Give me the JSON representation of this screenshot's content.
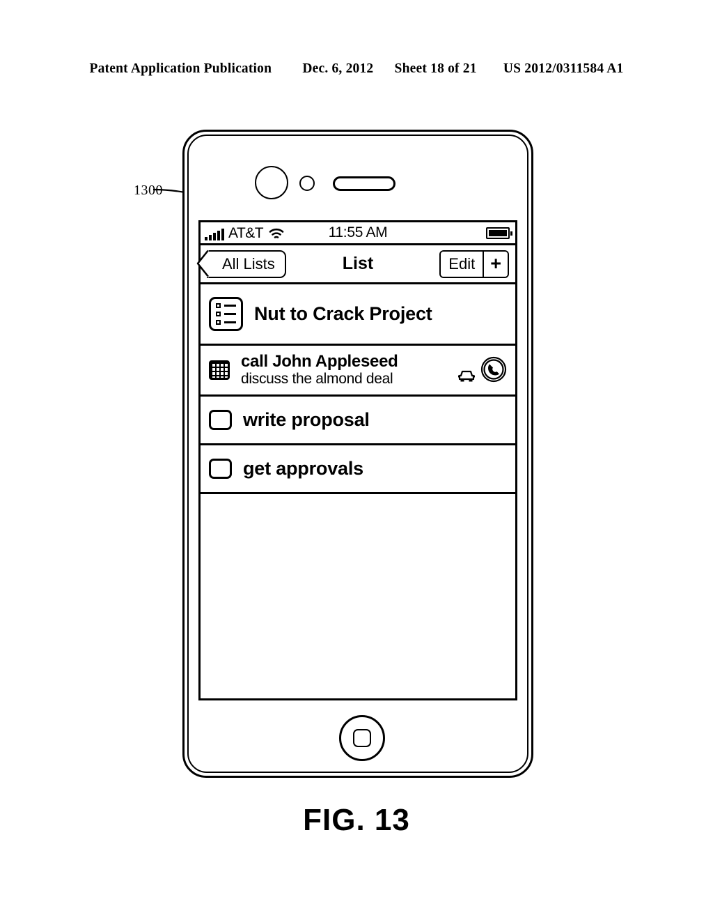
{
  "patent_header": {
    "publication": "Patent Application Publication",
    "date": "Dec. 6, 2012",
    "sheet": "Sheet 18 of 21",
    "number": "US 2012/0311584 A1"
  },
  "reference_numeral": "1300",
  "figure_caption": "FIG. 13",
  "device": {
    "hardware": {
      "camera_icon": "camera-lens",
      "sensor_icon": "proximity-sensor",
      "speaker_icon": "earpiece-speaker",
      "home_button_icon": "home-button"
    },
    "status_bar": {
      "signal_icon": "signal-bars",
      "signal_bars": 5,
      "carrier": "AT&T",
      "wifi_icon": "wifi-icon",
      "time": "11:55 AM",
      "battery_icon": "battery-full-icon"
    },
    "nav_bar": {
      "back_label": "All Lists",
      "back_icon": "chevron-left-icon",
      "title": "List",
      "edit_label": "Edit",
      "add_label": "+"
    },
    "list": {
      "rows": [
        {
          "type": "project",
          "icon": "checklist-icon",
          "title": "Nut to Crack Project"
        },
        {
          "type": "task",
          "icon": "grid-checkbox-icon",
          "title": "call John Appleseed",
          "subtitle": "discuss the almond deal",
          "accessories": [
            "car-icon",
            "phone-call-icon"
          ]
        },
        {
          "type": "task",
          "icon": "checkbox-icon",
          "title": "write proposal"
        },
        {
          "type": "task",
          "icon": "checkbox-icon",
          "title": "get approvals"
        }
      ]
    }
  },
  "colors": {
    "ink": "#000000",
    "paper": "#ffffff"
  }
}
